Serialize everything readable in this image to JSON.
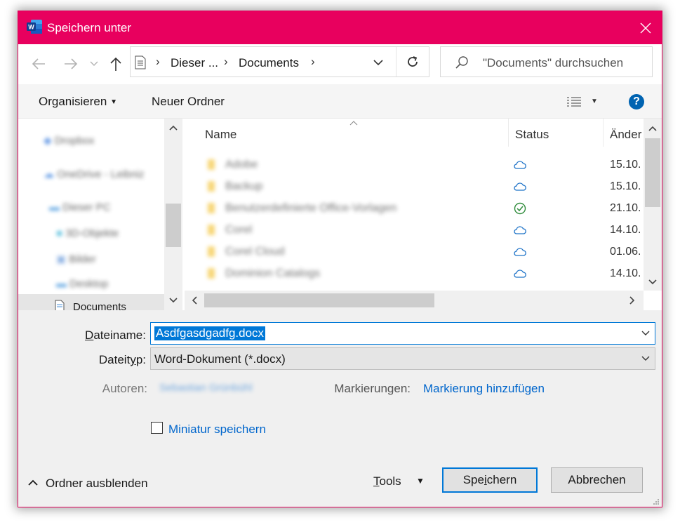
{
  "colors": {
    "accent": "#e8005e",
    "link": "#0066cc",
    "selection": "#0078d7"
  },
  "window": {
    "title": "Speichern unter",
    "app_icon": "word-icon",
    "close_icon": "close-icon"
  },
  "nav": {
    "back_icon": "arrow-left-icon",
    "forward_icon": "arrow-right-icon",
    "recent_icon": "chevron-down-icon",
    "up_icon": "arrow-up-icon",
    "breadcrumb": [
      "Dieser ...",
      "Documents"
    ],
    "refresh_icon": "refresh-icon",
    "search_placeholder": "\"Documents\" durchsuchen"
  },
  "toolbar": {
    "organize_label": "Organisieren",
    "new_folder_label": "Neuer Ordner",
    "view_icon": "view-details-icon",
    "help_label": "?"
  },
  "navpane": {
    "items": [
      {
        "label": "Dropbox",
        "blurred": true
      },
      {
        "label": "OneDrive - Leibniz",
        "blurred": true
      },
      {
        "label": "Dieser PC",
        "blurred": true
      },
      {
        "label": "3D-Objekte",
        "blurred": true
      },
      {
        "label": "Bilder",
        "blurred": true
      },
      {
        "label": "Desktop",
        "blurred": true
      },
      {
        "label": "Documents",
        "blurred": false
      }
    ]
  },
  "files": {
    "columns": {
      "name": "Name",
      "status": "Status",
      "date": "Änder"
    },
    "rows": [
      {
        "name": "Adobe",
        "status": "cloud",
        "date": "15.10."
      },
      {
        "name": "Backup",
        "status": "cloud",
        "date": "15.10."
      },
      {
        "name": "Benutzerdefinierte Office-Vorlagen",
        "status": "synced",
        "date": "21.10."
      },
      {
        "name": "Corel",
        "status": "cloud",
        "date": "14.10."
      },
      {
        "name": "Corel Cloud",
        "status": "cloud",
        "date": "01.06."
      },
      {
        "name": "Dominion Catalogs",
        "status": "cloud",
        "date": "14.10."
      }
    ]
  },
  "form": {
    "filename_label": "Dateiname:",
    "filename_value": "Asdfgasdgadfg.docx",
    "filetype_label": "Dateityp:",
    "filetype_value": "Word-Dokument (*.docx)",
    "authors_label": "Autoren:",
    "authors_value": "Sebastian Grünbühl",
    "tags_label": "Markierungen:",
    "tags_link": "Markierung hinzufügen",
    "thumbnail_label": "Miniatur speichern",
    "thumbnail_checked": false
  },
  "footer": {
    "hide_folders": "Ordner ausblenden",
    "tools": "Tools",
    "save": "Speichern",
    "cancel": "Abbrechen"
  }
}
